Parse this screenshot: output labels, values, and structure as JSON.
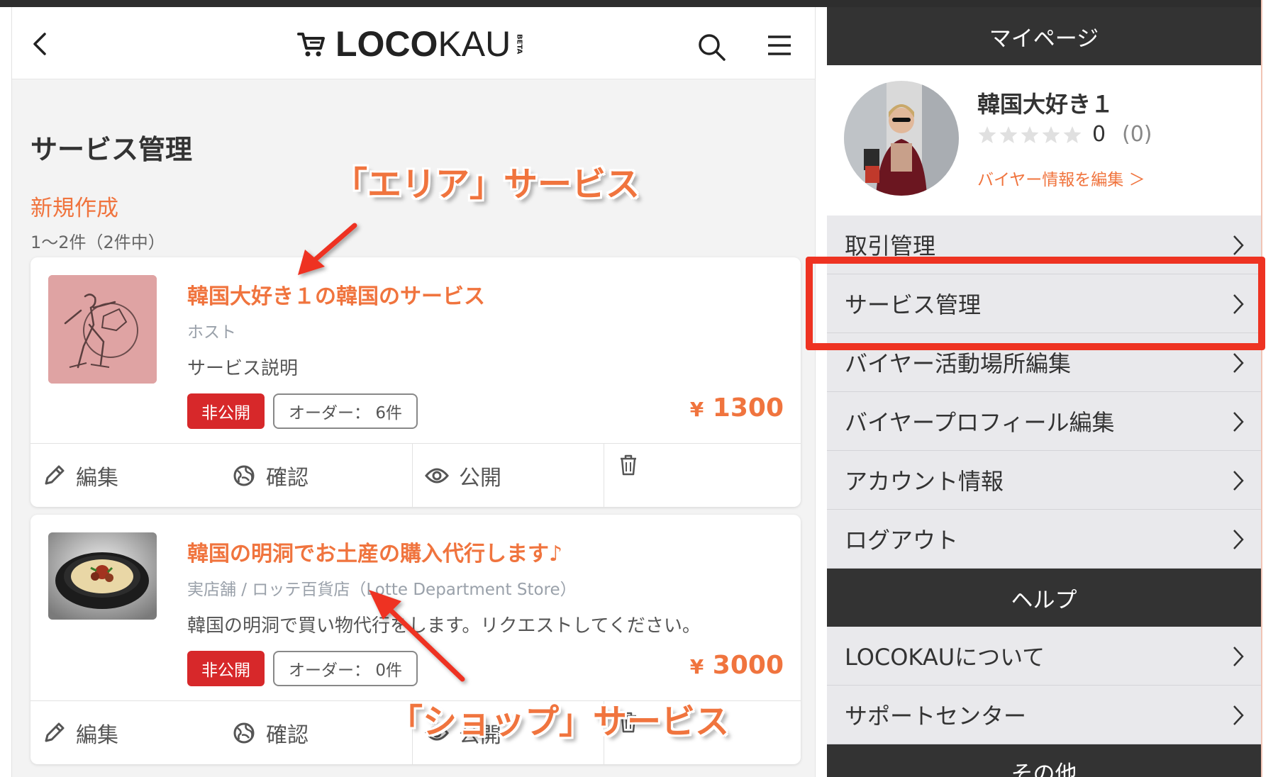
{
  "header": {
    "logo_bold": "LOCO",
    "logo_light": "KAU",
    "logo_beta": "BETA"
  },
  "main": {
    "page_title": "サービス管理",
    "new_link": "新規作成",
    "count_text": "1〜2件（2件中）"
  },
  "services": [
    {
      "title": "韓国大好き１の韓国のサービス",
      "subtitle": "ホスト",
      "description": "サービス説明",
      "status_badge": "非公開",
      "order_badge": "オーダー： 6件",
      "price_yen": "¥",
      "price_value": "1300",
      "actions": {
        "edit": "編集",
        "check": "確認",
        "publish": "公開"
      }
    },
    {
      "title": "韓国の明洞でお土産の購入代行します♪",
      "subtitle": "実店舗 / ロッテ百貨店（Lotte Department Store）",
      "description": "韓国の明洞で買い物代行をします。リクエストしてください。",
      "status_badge": "非公開",
      "order_badge": "オーダー： 0件",
      "price_yen": "¥",
      "price_value": "3000",
      "actions": {
        "edit": "編集",
        "check": "確認",
        "publish": "公開"
      }
    }
  ],
  "sidebar": {
    "mypage_header": "マイページ",
    "profile": {
      "name": "韓国大好き１",
      "rating": "0",
      "rating_count": "(0)",
      "edit_link": "バイヤー情報を編集 ＞"
    },
    "menu": [
      {
        "label": "取引管理"
      },
      {
        "label": "サービス管理"
      },
      {
        "label": "バイヤー活動場所編集"
      },
      {
        "label": "バイヤープロフィール編集"
      },
      {
        "label": "アカウント情報"
      },
      {
        "label": "ログアウト"
      }
    ],
    "help_header": "ヘルプ",
    "help_menu": [
      {
        "label": "LOCOKAUについて"
      },
      {
        "label": "サポートセンター"
      }
    ],
    "other_header": "その他"
  },
  "annotations": {
    "area_service": "「エリア」サービス",
    "shop_service": "「ショップ」サービス"
  },
  "colors": {
    "accent": "#f0743e",
    "private_badge": "#d7282a",
    "highlight": "#ee3322",
    "sidebar_header": "#333333"
  }
}
